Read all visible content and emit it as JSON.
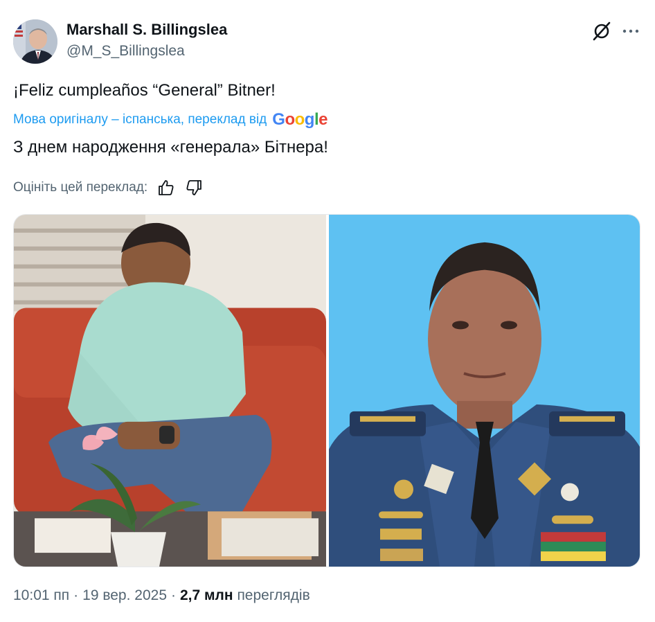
{
  "author": {
    "name": "Marshall S. Billingslea",
    "handle": "@M_S_Billingslea"
  },
  "icons": {
    "grok": "grok-icon",
    "more": "more-dots-icon",
    "thumbs_up": "thumbs-up-icon",
    "thumbs_down": "thumbs-down-icon"
  },
  "tweet": {
    "text": "¡Feliz cumpleaños “General” Bitner!",
    "translation_note": "Мова оригіналу – іспанська, переклад від",
    "translation_provider": [
      "G",
      "o",
      "o",
      "g",
      "l",
      "e"
    ],
    "translated_text": "З днем народження «генерала» Бітнера!",
    "rate_label": "Оцініть цей переклад:"
  },
  "meta": {
    "time": "10:01 пп",
    "separator": "·",
    "date": "19 вер. 2025",
    "views_count": "2,7 млн",
    "views_label": "переглядів"
  },
  "colors": {
    "text": "#0f1419",
    "secondary": "#536471",
    "link": "#1d9bf0",
    "photo_right_background": "#5ec1f2"
  }
}
